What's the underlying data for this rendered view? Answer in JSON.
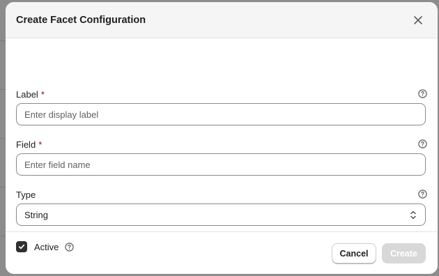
{
  "modal": {
    "title": "Create Facet Configuration"
  },
  "fields": {
    "label": {
      "label": "Label",
      "required_mark": "*",
      "placeholder": "Enter display label",
      "value": ""
    },
    "field": {
      "label": "Field",
      "required_mark": "*",
      "placeholder": "Enter field name",
      "value": ""
    },
    "type": {
      "label": "Type",
      "selected": "String"
    },
    "active": {
      "label": "Active",
      "checked": true
    }
  },
  "footer": {
    "cancel_label": "Cancel",
    "create_label": "Create"
  },
  "icons": {
    "close": "close-icon",
    "help": "question-circle-icon",
    "select": "chevron-up-down-icon",
    "check": "checkmark-icon"
  },
  "colors": {
    "required": "#8e0b21",
    "checkbox": "#303030",
    "disabled_button": "#d8d8d8",
    "header_bg": "#f5f5f5"
  }
}
